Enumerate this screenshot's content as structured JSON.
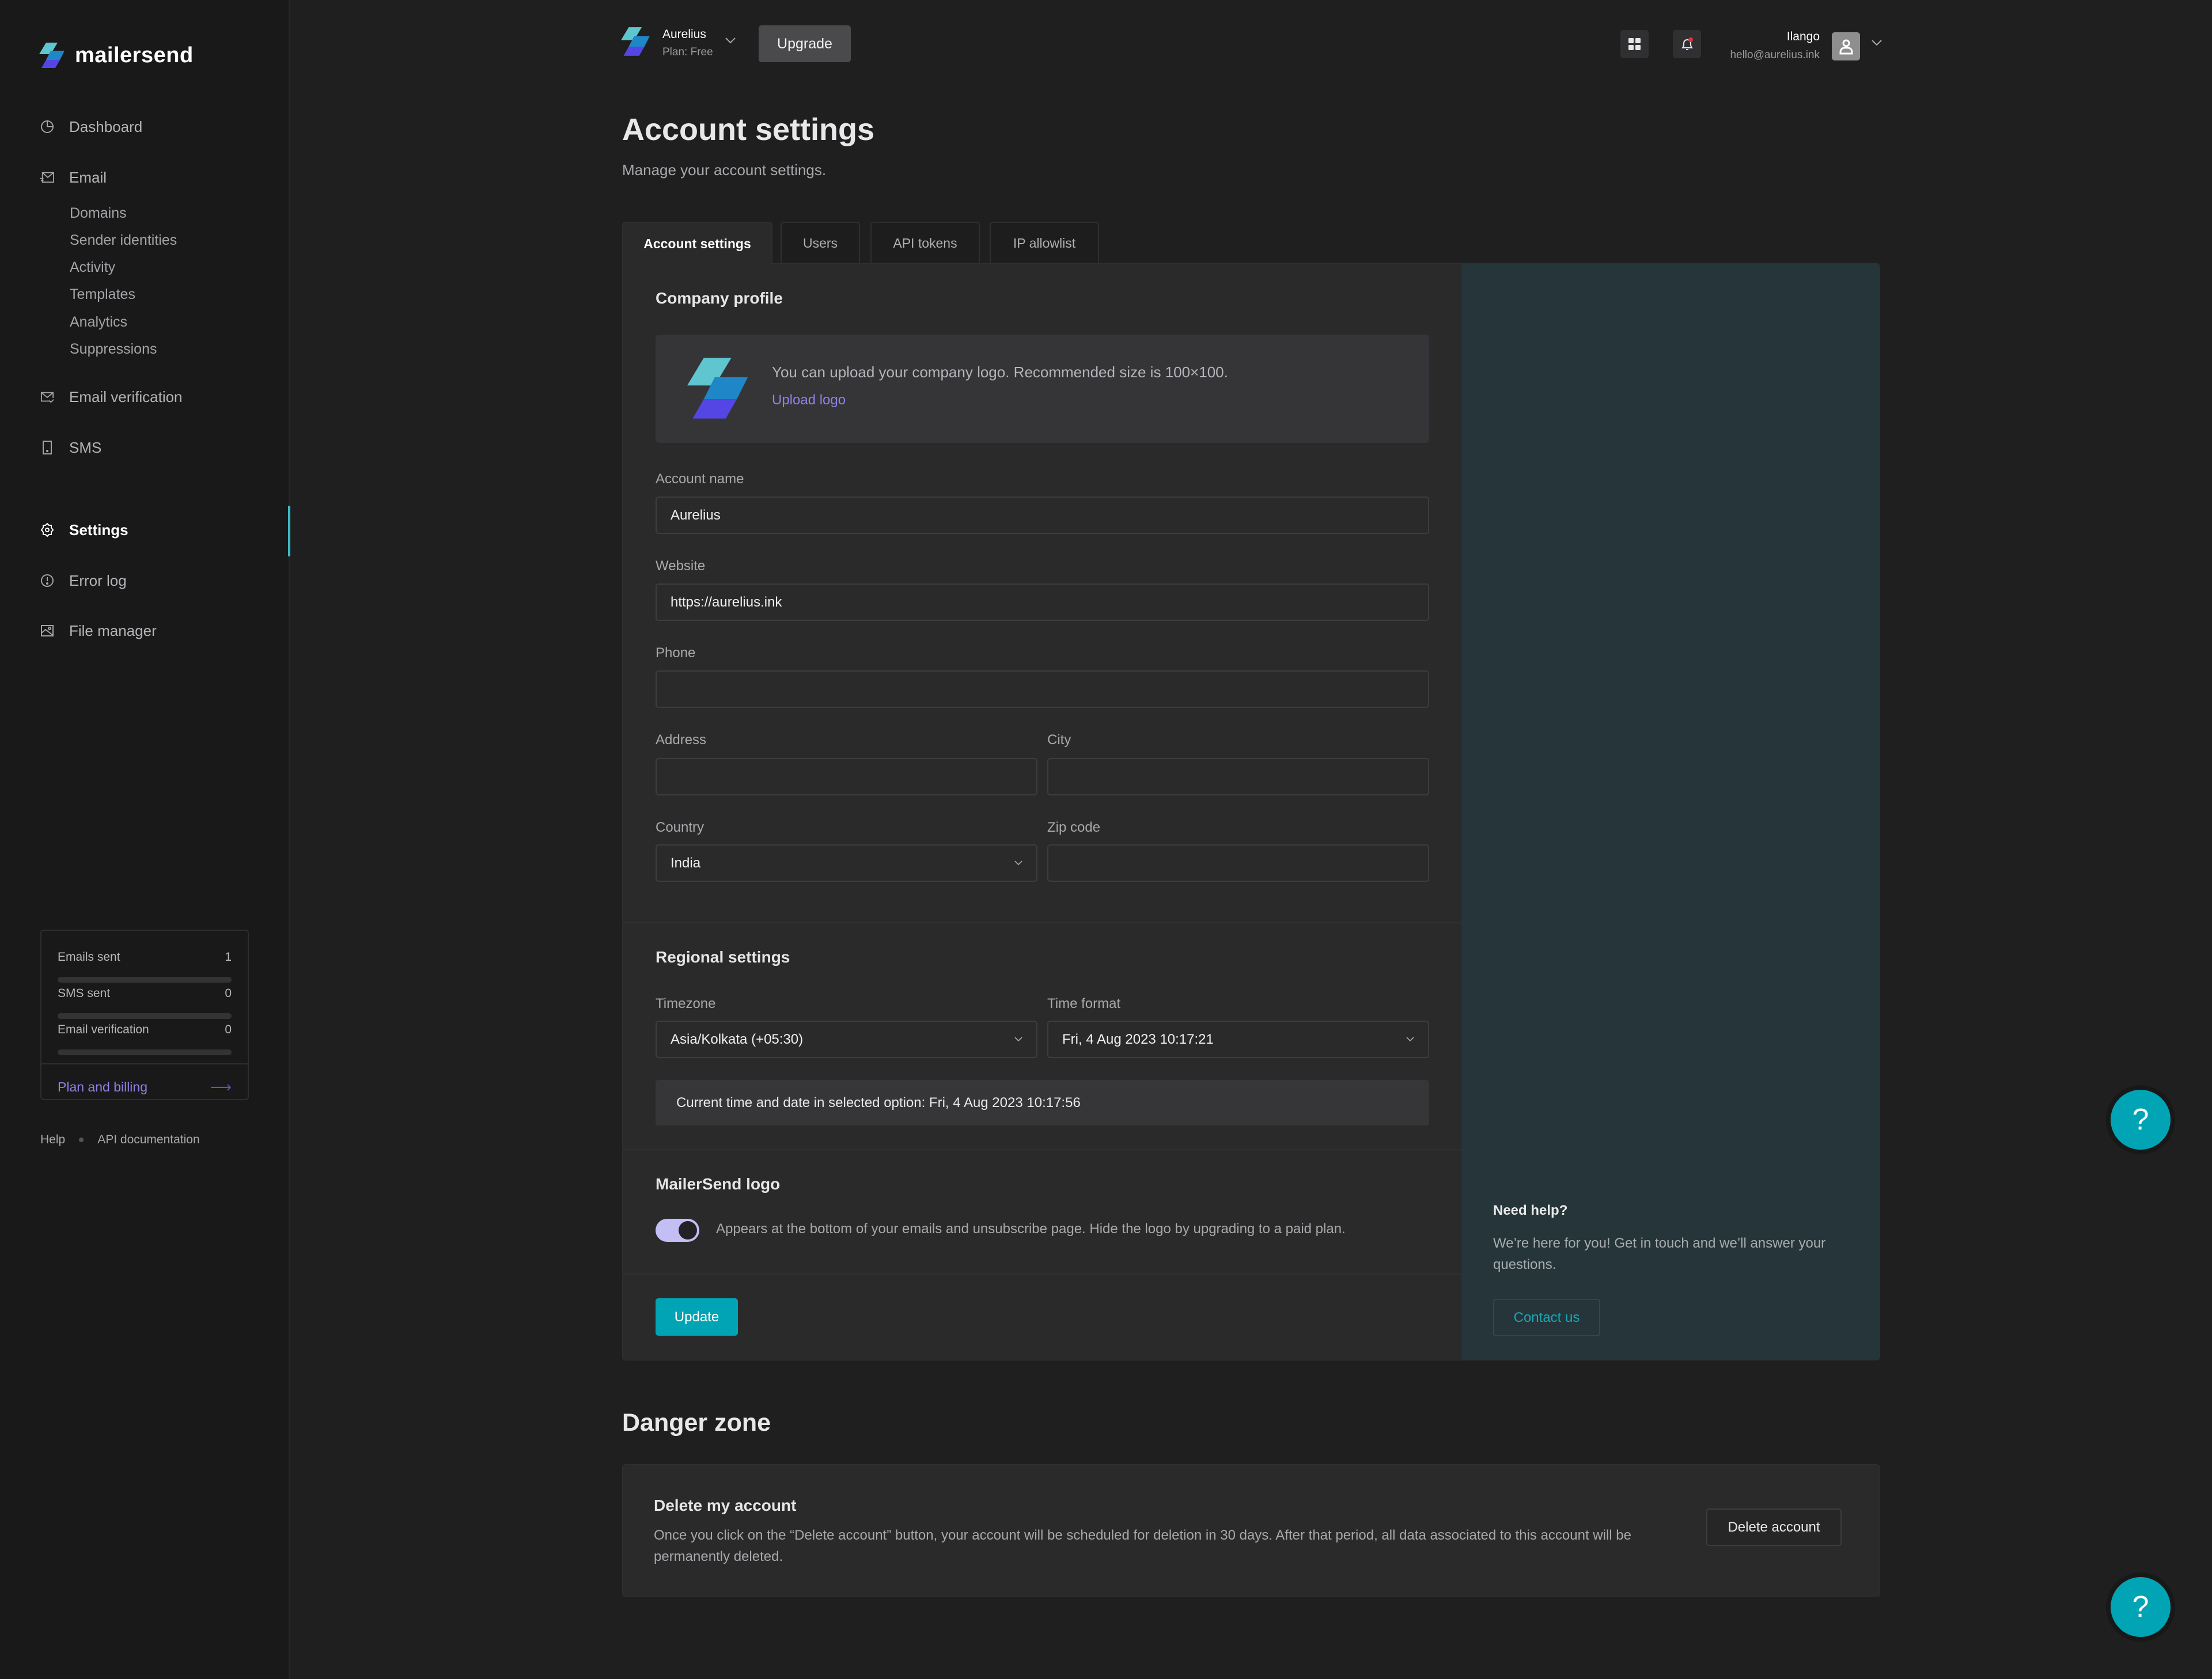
{
  "brand": {
    "name": "mailersend",
    "icon": "mailersend-logo-icon"
  },
  "sidebar": {
    "items": [
      {
        "label": "Dashboard",
        "icon": "pie-chart-icon"
      },
      {
        "label": "Email",
        "icon": "email-send-icon"
      },
      {
        "label": "Email verification",
        "icon": "email-check-icon"
      },
      {
        "label": "SMS",
        "icon": "phone-icon"
      },
      {
        "label": "Settings",
        "icon": "gear-icon",
        "active": true
      },
      {
        "label": "Error log",
        "icon": "alert-circle-icon"
      },
      {
        "label": "File manager",
        "icon": "image-icon"
      }
    ],
    "email_subitems": [
      "Domains",
      "Sender identities",
      "Activity",
      "Templates",
      "Analytics",
      "Suppressions"
    ],
    "usage": [
      {
        "label": "Emails sent",
        "value": "1",
        "progress": 0
      },
      {
        "label": "SMS sent",
        "value": "0",
        "progress": 0
      },
      {
        "label": "Email verification",
        "value": "0",
        "progress": 0
      }
    ],
    "plan_link": "Plan and billing",
    "plan_arrow": "⟶",
    "footer_links": [
      "Help",
      "API documentation"
    ]
  },
  "topbar": {
    "workspace_name": "Aurelius",
    "workspace_plan": "Plan: Free",
    "upgrade_label": "Upgrade",
    "user_name": "Ilango",
    "user_email": "hello@aurelius.ink",
    "notification_badge": true
  },
  "page": {
    "title": "Account settings",
    "subtitle": "Manage your account settings."
  },
  "tabs": [
    {
      "label": "Account settings",
      "active": true
    },
    {
      "label": "Users"
    },
    {
      "label": "API tokens"
    },
    {
      "label": "IP allowlist"
    }
  ],
  "company_profile": {
    "title": "Company profile",
    "logo_message": "You can upload your company logo. Recommended size is 100×100.",
    "upload_label": "Upload logo",
    "fields": {
      "account_name": {
        "label": "Account name",
        "value": "Aurelius"
      },
      "website": {
        "label": "Website",
        "value": "https://aurelius.ink"
      },
      "phone": {
        "label": "Phone",
        "value": ""
      },
      "address": {
        "label": "Address",
        "value": ""
      },
      "city": {
        "label": "City",
        "value": ""
      },
      "country": {
        "label": "Country",
        "value": "India"
      },
      "zip": {
        "label": "Zip code",
        "value": ""
      }
    }
  },
  "regional": {
    "title": "Regional settings",
    "timezone_label": "Timezone",
    "timezone_value": "Asia/Kolkata (+05:30)",
    "time_format_label": "Time format",
    "time_format_value": "Fri, 4 Aug 2023 10:17:21",
    "current_time_text": "Current time and date in selected option: Fri, 4 Aug 2023 10:17:56"
  },
  "mailersend_logo": {
    "title": "MailerSend logo",
    "toggle_on": true,
    "description": "Appears at the bottom of your emails and unsubscribe page. Hide the logo by upgrading to a paid plan."
  },
  "update_label": "Update",
  "help_panel": {
    "title": "Need help?",
    "text": "We’re here for you! Get in touch and we’ll answer your questions.",
    "contact_label": "Contact us"
  },
  "danger_zone": {
    "title": "Danger zone",
    "box_title": "Delete my account",
    "box_text": "Once you click on the “Delete account” button, your account will be scheduled for deletion in 30 days. After that period, all data associated to this account will be permanently deleted.",
    "delete_label": "Delete account"
  },
  "fab_label": "?",
  "colors": {
    "accent_teal": "#00a4b4",
    "accent_purple": "#8c82e6",
    "sidebar_bg": "#191919",
    "main_bg": "#1f1f1f",
    "card_bg": "#2a2a2a",
    "help_panel_bg": "#25353a"
  }
}
